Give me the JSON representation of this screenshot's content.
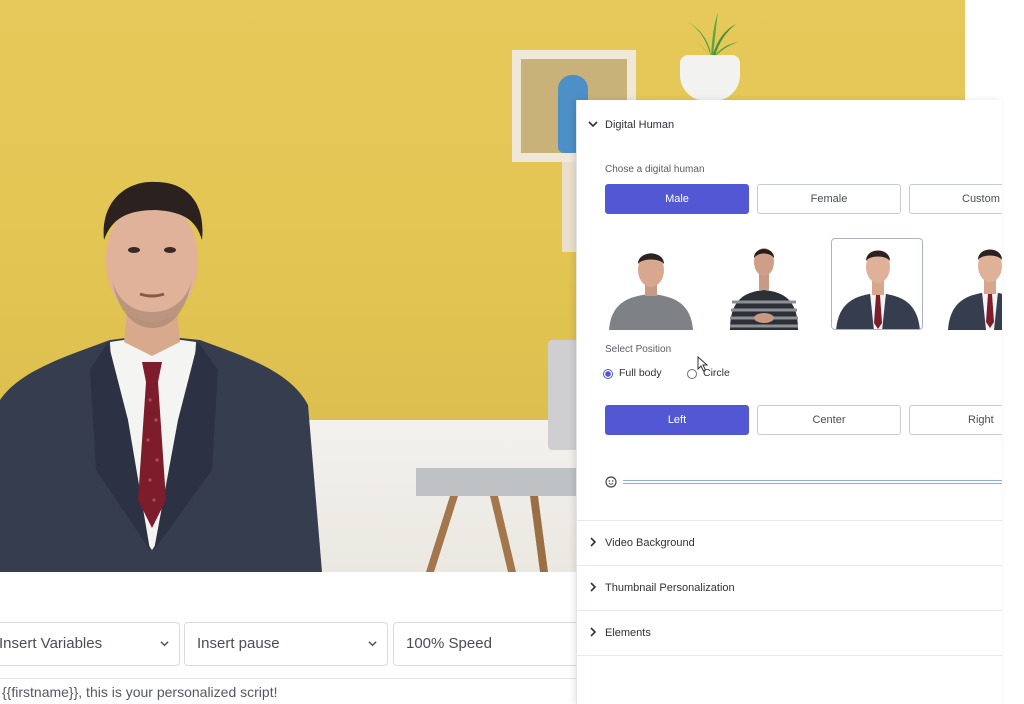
{
  "script_editor": {
    "insert_variables": "Insert Variables",
    "insert_pause": "Insert pause",
    "speed": "100% Speed",
    "script_text": "{{firstname}}, this is your personalized script!"
  },
  "panel": {
    "digital_human": {
      "title": "Digital Human",
      "choose_label": "Chose a digital human",
      "gender_tabs": [
        "Male",
        "Female",
        "Custom"
      ],
      "active_gender": "Male",
      "position_label": "Select Position",
      "position_options": [
        "Full body",
        "Circle"
      ],
      "selected_position": "Full body",
      "alignment_buttons": [
        "Left",
        "Center",
        "Right"
      ],
      "active_alignment": "Left"
    },
    "collapsed_sections": [
      "Video Background",
      "Thumbnail Personalization",
      "Elements"
    ]
  },
  "colors": {
    "accent": "#5258d4",
    "wall_yellow": "#e3c553"
  },
  "icons": {
    "section_expanded": "chevron-down-icon",
    "section_collapsed": "chevron-right-icon",
    "dropdown": "chevron-down-icon",
    "slider": "face-icon"
  }
}
